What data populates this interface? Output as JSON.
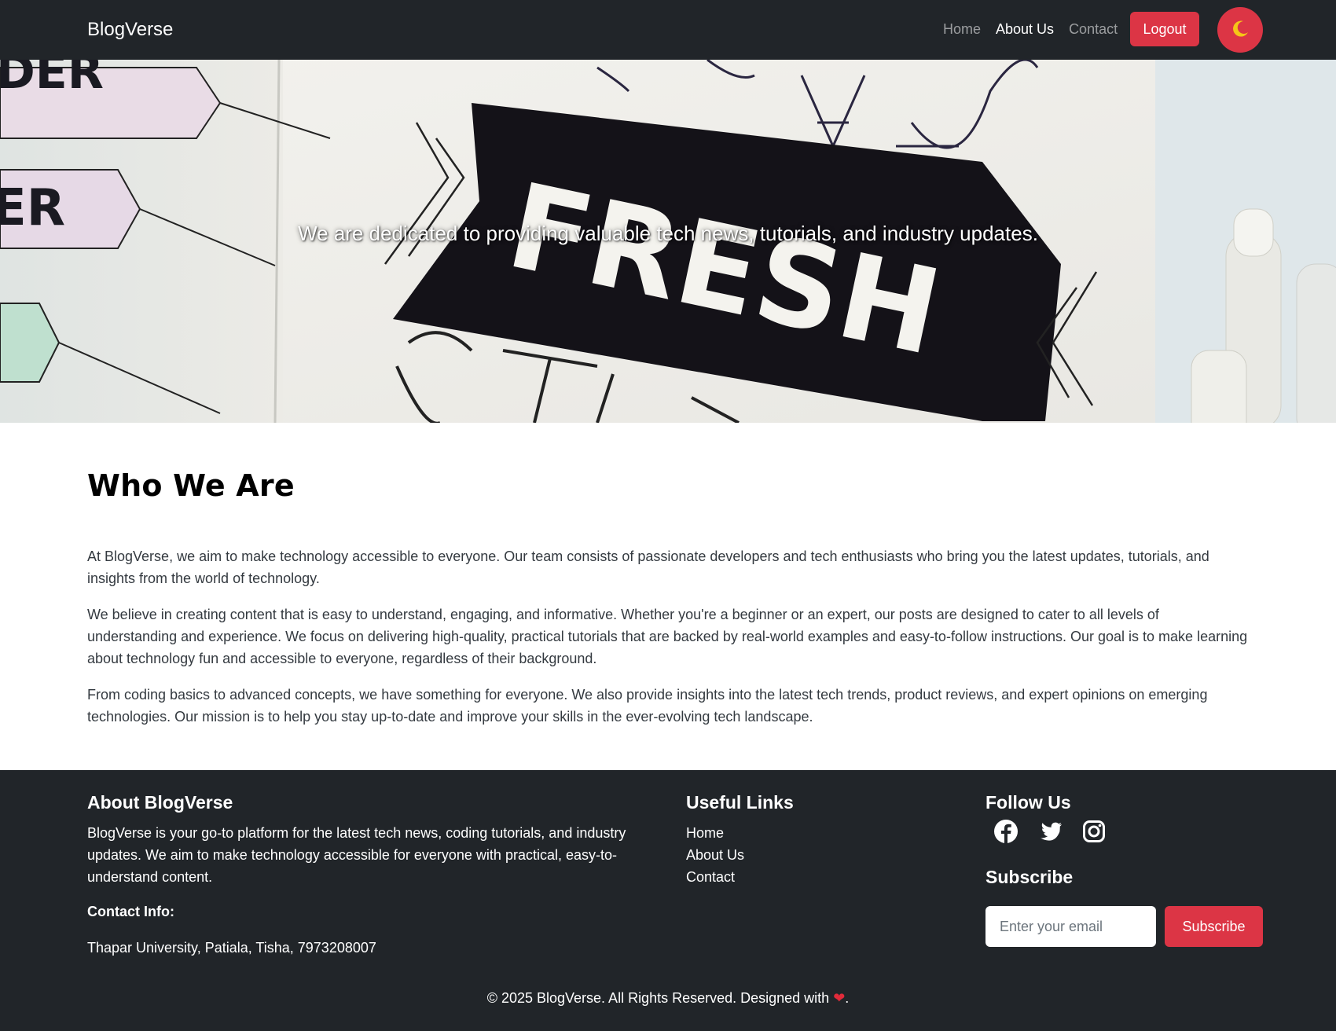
{
  "navbar": {
    "brand": "BlogVerse",
    "links": [
      {
        "label": "Home",
        "active": false
      },
      {
        "label": "About Us",
        "active": true
      },
      {
        "label": "Contact",
        "active": false
      }
    ],
    "logout_label": "Logout",
    "theme_icon": "moon-icon"
  },
  "hero": {
    "tagline": "We are dedicated to providing valuable tech news, tutorials, and industry updates.",
    "image": "notebook-fresh-start-photo"
  },
  "about": {
    "heading": "Who We Are",
    "paragraphs": [
      "At BlogVerse, we aim to make technology accessible to everyone. Our team consists of passionate developers and tech enthusiasts who bring you the latest updates, tutorials, and insights from the world of technology.",
      "We believe in creating content that is easy to understand, engaging, and informative. Whether you're a beginner or an expert, our posts are designed to cater to all levels of understanding and experience. We focus on delivering high-quality, practical tutorials that are backed by real-world examples and easy-to-follow instructions. Our goal is to make learning about technology fun and accessible to everyone, regardless of their background.",
      "From coding basics to advanced concepts, we have something for everyone. We also provide insights into the latest tech trends, product reviews, and expert opinions on emerging technologies. Our mission is to help you stay up-to-date and improve your skills in the ever-evolving tech landscape."
    ]
  },
  "footer": {
    "about_heading": "About BlogVerse",
    "about_text": "BlogVerse is your go-to platform for the latest tech news, coding tutorials, and industry updates. We aim to make technology accessible for everyone with practical, easy-to-understand content.",
    "contact_label": "Contact Info:",
    "contact_value": "Thapar University, Patiala, Tisha, 7973208007",
    "links_heading": "Useful Links",
    "links": [
      "Home",
      "About Us",
      "Contact"
    ],
    "follow_heading": "Follow Us",
    "socials": [
      "facebook-icon",
      "twitter-icon",
      "instagram-icon"
    ],
    "subscribe_heading": "Subscribe",
    "email_placeholder": "Enter your email",
    "subscribe_label": "Subscribe",
    "copyright_prefix": "© 2025 BlogVerse. All Rights Reserved. Designed with",
    "copyright_suffix": "."
  },
  "colors": {
    "navbar_bg": "#212529",
    "accent": "#dc3545",
    "footer_bg": "#212529"
  }
}
